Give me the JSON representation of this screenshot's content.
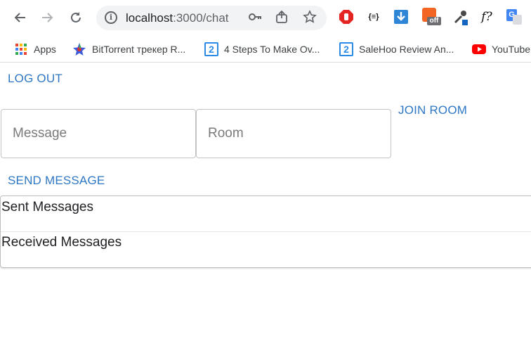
{
  "browser": {
    "url_host": "localhost",
    "url_rest": ":3000/chat",
    "nav": {
      "back": "←",
      "forward": "→",
      "reload": "↻"
    },
    "extensions": [
      "adblock-icon",
      "json-viewer-icon",
      "download-icon",
      "coupon-off-icon",
      "eyedropper-icon",
      "function-icon",
      "translate-icon"
    ],
    "json_label": "{≡}",
    "off_label": "off",
    "f_label": "f?",
    "g_label": "G"
  },
  "bookmarks": [
    {
      "label": "Apps",
      "icon": "apps-grid-icon"
    },
    {
      "label": "BitTorrent трекер R...",
      "icon": "bittorrent-icon"
    },
    {
      "label": "4 Steps To Make Ov...",
      "icon": "two-icon"
    },
    {
      "label": "SaleHoo Review An...",
      "icon": "two-icon"
    },
    {
      "label": "YouTube",
      "icon": "youtube-icon"
    }
  ],
  "bookmark_two_glyph": "2",
  "page": {
    "logout_label": "LOG OUT",
    "join_room_label": "JOIN ROOM",
    "message_placeholder": "Message",
    "room_placeholder": "Room",
    "send_label": "SEND MESSAGE",
    "sent_heading": "Sent Messages",
    "received_heading": "Received Messages"
  },
  "colors": {
    "link": "#2e77c4",
    "border": "#c4c4c4"
  }
}
